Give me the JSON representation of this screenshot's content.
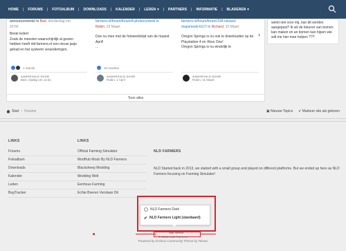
{
  "nav": {
    "items": [
      {
        "label": "HOME",
        "caret": false
      },
      {
        "label": "FORUMS",
        "caret": false
      },
      {
        "label": "FOTOALBUM",
        "caret": false
      },
      {
        "label": "DOWNLOADS",
        "caret": false
      },
      {
        "label": "KALENDER",
        "caret": false
      },
      {
        "label": "LEDEN",
        "caret": true
      },
      {
        "label": "PARTNERS",
        "caret": false
      },
      {
        "label": "INFORMATIE",
        "caret": false
      },
      {
        "label": "BLADEREN",
        "caret": true
      }
    ],
    "search_icon": "search-icon",
    "bg_color": "#2d4b68"
  },
  "posts": [
    {
      "line1": "announcements/ in",
      "by": "Bart",
      "when": ", donderdag om",
      "time": "20:56",
      "body": "Beste leden!\nZoals de meesten waarschijnlijk al gezien hebben heeft nld-farmers.nl een nieuw jasje gehad en het systeem veranderingen.",
      "reactions": "1 reactie",
      "author_label": "AANGEVULD DOOR",
      "author": "Bart, vrijdag om 11:51"
    },
    {
      "line1": "farmers.nl/forum/forum/4-photocontest/ in",
      "by": "Robin",
      "when": ", 23 Maart",
      "time": "",
      "body": "Doe nu mee met de fotowedstrijd van de maand April!\n...",
      "reactions": "10 reacties",
      "author_label": "AANGEVULD DOOR",
      "author": "Robin, 1 April"
    },
    {
      "line1": "farmers.nl/forum/forum/104-nieuws/",
      "line1b": "mapsmods-fs17/ in",
      "by": "Richard",
      "when": ", 15 Maart",
      "time": "",
      "body": "Oregon Springs is nu ook te downloaden op de Playstation 4 en Xbox One!\nOregon Springs is nu eindelijk te",
      "reactions": "",
      "author_label": "AANGEVULD DOOR",
      "author": "Robin, 11 Maart"
    }
  ],
  "show_all": "Toon alles",
  "sidebar": {
    "text": "werkt niet voor mij, kan dit worden aangepast? Ik wil de kleuren van bomen kan maken en an bomen kan hijsen  wie wilt me hier mee helpen ???"
  },
  "breadcrumb": {
    "home": "Start",
    "current": "Forums"
  },
  "top_actions": {
    "new_topics": "Nieuwe Topics",
    "mark_read": "Markeer site als gelezen"
  },
  "footer": {
    "links_heading_1": "LINKS",
    "links_1": [
      "Forums",
      "Fotoalbum",
      "Downloads",
      "Kalender",
      "Leden",
      "BugTracker"
    ],
    "links_heading_2": "LINKS",
    "links_2": [
      "Official Farming Simulator",
      "ModHub Mods By NLD Farmers",
      "Blacksheep Modding",
      "Modding Welt",
      "Eenhous Farming",
      "Echte Boeren Verstaan Dit"
    ],
    "nld_heading": "NLD FARMERS",
    "nld_text": "NLD Started back in 2013, we started with a small group and played on different platforms. But we ended up here as NLD Farmers focusing on Farming Simulator!"
  },
  "style_picker": {
    "options": [
      {
        "label": "NLD Farmers Dark",
        "selected": false
      },
      {
        "label": "NLD Farmers Light (standaard)",
        "selected": true
      }
    ],
    "trigger_label": "Stijl thema",
    "highlight_color": "#e0202a"
  },
  "copyright": {
    "line1": "© 2018 NLD Farmers",
    "line2": "Powered by Invision Community   Theme by Tahran"
  }
}
